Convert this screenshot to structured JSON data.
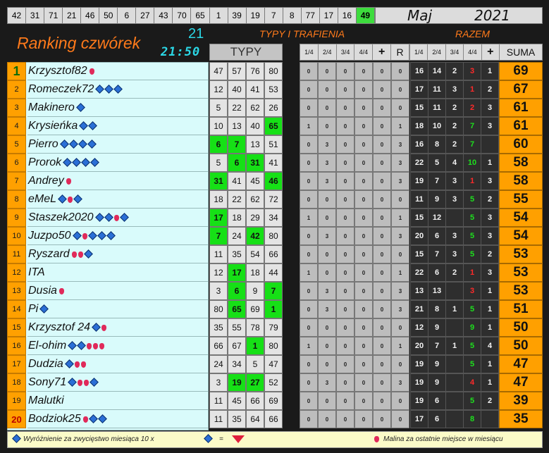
{
  "number_strip": [
    "42",
    "31",
    "71",
    "21",
    "46",
    "50",
    "6",
    "27",
    "43",
    "70",
    "65",
    "1",
    "39",
    "19",
    "7",
    "8",
    "77",
    "17",
    "16",
    "49"
  ],
  "number_strip_highlight": "49",
  "month": {
    "name": "Maj",
    "year": "2021"
  },
  "header": {
    "title": "Ranking czwórek",
    "count": "21",
    "time": "21:50",
    "typy_trafienia": "TYPY I TRAFIENIA",
    "razem": "RAZEM",
    "typy": "TYPY",
    "suma": "SUMA",
    "gray_cols": [
      "1/4",
      "2/4",
      "3/4",
      "4/4",
      "+",
      "R"
    ],
    "dark_cols": [
      "1/4",
      "2/4",
      "3/4",
      "4/4",
      "+"
    ]
  },
  "rows": [
    {
      "rank": "1",
      "name": "Krzysztof82",
      "badges": [
        "b"
      ],
      "typy": [
        "47",
        "57",
        "76",
        "80"
      ],
      "hits": [
        0,
        0,
        0,
        0
      ],
      "gray": [
        "0",
        "0",
        "0",
        "0",
        "0",
        "0"
      ],
      "dark": [
        "16",
        "14",
        "2",
        "3",
        "1"
      ],
      "suma": "69"
    },
    {
      "rank": "2",
      "name": "Romeczek72",
      "badges": [
        "d",
        "d",
        "d"
      ],
      "typy": [
        "12",
        "40",
        "41",
        "53"
      ],
      "hits": [
        0,
        0,
        0,
        0
      ],
      "gray": [
        "0",
        "0",
        "0",
        "0",
        "0",
        "0"
      ],
      "dark": [
        "17",
        "11",
        "3",
        "1",
        "2"
      ],
      "suma": "67"
    },
    {
      "rank": "3",
      "name": "Makinero",
      "badges": [
        "d"
      ],
      "typy": [
        "5",
        "22",
        "62",
        "26"
      ],
      "hits": [
        0,
        0,
        0,
        0
      ],
      "gray": [
        "0",
        "0",
        "0",
        "0",
        "0",
        "0"
      ],
      "dark": [
        "15",
        "11",
        "2",
        "2",
        "3"
      ],
      "suma": "61"
    },
    {
      "rank": "4",
      "name": "Krysieńka",
      "badges": [
        "d",
        "d"
      ],
      "typy": [
        "10",
        "13",
        "40",
        "65"
      ],
      "hits": [
        0,
        0,
        0,
        1
      ],
      "gray": [
        "1",
        "0",
        "0",
        "0",
        "0",
        "1"
      ],
      "dark": [
        "18",
        "10",
        "2",
        "7",
        "3"
      ],
      "suma": "61"
    },
    {
      "rank": "5",
      "name": "Pierro",
      "badges": [
        "d",
        "d",
        "d",
        "d"
      ],
      "typy": [
        "6",
        "7",
        "13",
        "51"
      ],
      "hits": [
        1,
        1,
        0,
        0
      ],
      "gray": [
        "0",
        "3",
        "0",
        "0",
        "0",
        "3"
      ],
      "dark": [
        "16",
        "8",
        "2",
        "7",
        ""
      ],
      "suma": "60"
    },
    {
      "rank": "6",
      "name": "Prorok",
      "badges": [
        "d",
        "d",
        "d",
        "d"
      ],
      "typy": [
        "5",
        "6",
        "31",
        "41"
      ],
      "hits": [
        0,
        1,
        1,
        0
      ],
      "gray": [
        "0",
        "3",
        "0",
        "0",
        "0",
        "3"
      ],
      "dark": [
        "22",
        "5",
        "4",
        "10",
        "1"
      ],
      "suma": "58"
    },
    {
      "rank": "7",
      "name": "Andrey",
      "badges": [
        "b"
      ],
      "typy": [
        "31",
        "41",
        "45",
        "46"
      ],
      "hits": [
        1,
        0,
        0,
        1
      ],
      "gray": [
        "0",
        "3",
        "0",
        "0",
        "0",
        "3"
      ],
      "dark": [
        "19",
        "7",
        "3",
        "1",
        "3"
      ],
      "suma": "58"
    },
    {
      "rank": "8",
      "name": "eMeL",
      "badges": [
        "d",
        "b",
        "d"
      ],
      "typy": [
        "18",
        "22",
        "62",
        "72"
      ],
      "hits": [
        0,
        0,
        0,
        0
      ],
      "gray": [
        "0",
        "0",
        "0",
        "0",
        "0",
        "0"
      ],
      "dark": [
        "11",
        "9",
        "3",
        "5",
        "2"
      ],
      "suma": "55"
    },
    {
      "rank": "9",
      "name": "Staszek2020",
      "badges": [
        "d",
        "d",
        "b",
        "d"
      ],
      "typy": [
        "17",
        "18",
        "29",
        "34"
      ],
      "hits": [
        1,
        0,
        0,
        0
      ],
      "gray": [
        "1",
        "0",
        "0",
        "0",
        "0",
        "1"
      ],
      "dark": [
        "15",
        "12",
        "",
        "5",
        "3"
      ],
      "suma": "54"
    },
    {
      "rank": "10",
      "name": "Juzpo50",
      "badges": [
        "d",
        "b",
        "d",
        "d",
        "d"
      ],
      "typy": [
        "7",
        "24",
        "42",
        "80"
      ],
      "hits": [
        1,
        0,
        1,
        0
      ],
      "gray": [
        "0",
        "3",
        "0",
        "0",
        "0",
        "3"
      ],
      "dark": [
        "20",
        "6",
        "3",
        "5",
        "3"
      ],
      "suma": "54"
    },
    {
      "rank": "11",
      "name": "Ryszard",
      "badges": [
        "b",
        "b",
        "d"
      ],
      "typy": [
        "11",
        "35",
        "54",
        "66"
      ],
      "hits": [
        0,
        0,
        0,
        0
      ],
      "gray": [
        "0",
        "0",
        "0",
        "0",
        "0",
        "0"
      ],
      "dark": [
        "15",
        "7",
        "3",
        "5",
        "2"
      ],
      "suma": "53"
    },
    {
      "rank": "12",
      "name": "ITA",
      "badges": [],
      "typy": [
        "12",
        "17",
        "18",
        "44"
      ],
      "hits": [
        0,
        1,
        0,
        0
      ],
      "gray": [
        "1",
        "0",
        "0",
        "0",
        "0",
        "1"
      ],
      "dark": [
        "22",
        "6",
        "2",
        "1",
        "3"
      ],
      "suma": "53"
    },
    {
      "rank": "13",
      "name": "Dusia",
      "badges": [
        "b"
      ],
      "typy": [
        "3",
        "6",
        "9",
        "7"
      ],
      "hits": [
        0,
        1,
        0,
        1
      ],
      "gray": [
        "0",
        "3",
        "0",
        "0",
        "0",
        "3"
      ],
      "dark": [
        "13",
        "13",
        "",
        "3",
        "1"
      ],
      "suma": "53"
    },
    {
      "rank": "14",
      "name": "Pi",
      "badges": [
        "d"
      ],
      "typy": [
        "80",
        "65",
        "69",
        "1"
      ],
      "hits": [
        0,
        1,
        0,
        1
      ],
      "gray": [
        "0",
        "3",
        "0",
        "0",
        "0",
        "3"
      ],
      "dark": [
        "21",
        "8",
        "1",
        "5",
        "1"
      ],
      "suma": "51"
    },
    {
      "rank": "15",
      "name": "Krzysztof 24",
      "badges": [
        "d",
        "b"
      ],
      "typy": [
        "35",
        "55",
        "78",
        "79"
      ],
      "hits": [
        0,
        0,
        0,
        0
      ],
      "gray": [
        "0",
        "0",
        "0",
        "0",
        "0",
        "0"
      ],
      "dark": [
        "12",
        "9",
        "",
        "9",
        "1"
      ],
      "suma": "50"
    },
    {
      "rank": "16",
      "name": "El-ohim",
      "badges": [
        "d",
        "d",
        "b",
        "b",
        "b"
      ],
      "typy": [
        "66",
        "67",
        "1",
        "80"
      ],
      "hits": [
        0,
        0,
        1,
        0
      ],
      "gray": [
        "1",
        "0",
        "0",
        "0",
        "0",
        "1"
      ],
      "dark": [
        "20",
        "7",
        "1",
        "5",
        "4"
      ],
      "suma": "50"
    },
    {
      "rank": "17",
      "name": "Dudzia",
      "badges": [
        "d",
        "b",
        "b"
      ],
      "typy": [
        "24",
        "34",
        "5",
        "47"
      ],
      "hits": [
        0,
        0,
        0,
        0
      ],
      "gray": [
        "0",
        "0",
        "0",
        "0",
        "0",
        "0"
      ],
      "dark": [
        "19",
        "9",
        "",
        "5",
        "1"
      ],
      "suma": "47"
    },
    {
      "rank": "18",
      "name": "Sony71",
      "badges": [
        "d",
        "b",
        "b",
        "d"
      ],
      "typy": [
        "3",
        "19",
        "27",
        "52"
      ],
      "hits": [
        0,
        1,
        1,
        0
      ],
      "gray": [
        "0",
        "3",
        "0",
        "0",
        "0",
        "3"
      ],
      "dark": [
        "19",
        "9",
        "",
        "4",
        "1"
      ],
      "suma": "47"
    },
    {
      "rank": "19",
      "name": "Malutki",
      "badges": [],
      "typy": [
        "11",
        "45",
        "66",
        "69"
      ],
      "hits": [
        0,
        0,
        0,
        0
      ],
      "gray": [
        "0",
        "0",
        "0",
        "0",
        "0",
        "0"
      ],
      "dark": [
        "19",
        "6",
        "",
        "5",
        "2"
      ],
      "suma": "39"
    },
    {
      "rank": "20",
      "name": "Bodziok25",
      "badges": [
        "b",
        "d",
        "d"
      ],
      "typy": [
        "11",
        "35",
        "64",
        "66"
      ],
      "hits": [
        0,
        0,
        0,
        0
      ],
      "gray": [
        "0",
        "0",
        "0",
        "0",
        "0",
        "0"
      ],
      "dark": [
        "17",
        "6",
        "",
        "8",
        ""
      ],
      "suma": "35"
    }
  ],
  "footer": {
    "left_text": "Wyróżnienie za zwycięstwo miesiąca  10 x",
    "equals": "=",
    "right_text": "Malina za ostatnie miejsce w miesiącu"
  },
  "icons": {
    "diamond": "diamond-icon",
    "berry": "raspberry-icon",
    "gem": "ruby-gem-icon"
  },
  "colors": {
    "orange": "#ffa000",
    "hit_green": "#16e016",
    "cyan": "#2bd8e6",
    "red": "#ff2a2a"
  }
}
